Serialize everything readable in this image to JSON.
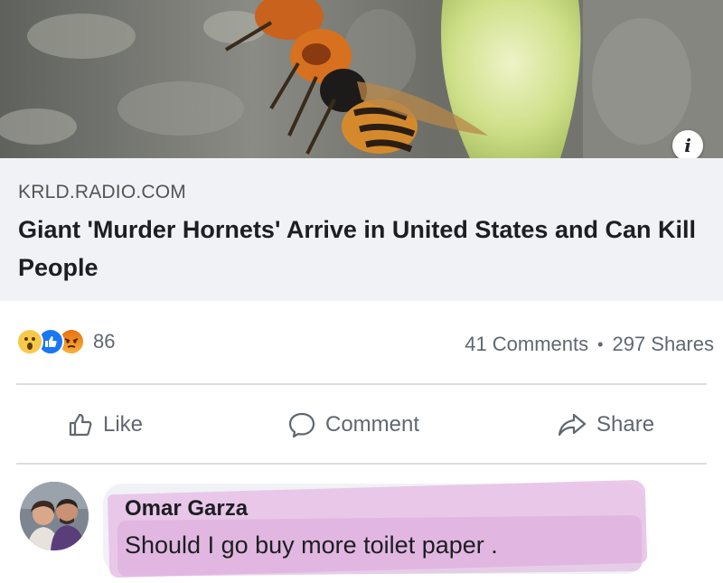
{
  "link_preview": {
    "domain": "KRLD.RADIO.COM",
    "title": "Giant 'Murder Hornets' Arrive in United States and Can Kill People",
    "info_icon": "info-icon",
    "info_glyph": "i"
  },
  "stats": {
    "reactions": [
      "wow-reaction-icon",
      "like-reaction-icon",
      "angry-reaction-icon"
    ],
    "reaction_count": "86",
    "comments": "41 Comments",
    "separator": "•",
    "shares": "297 Shares"
  },
  "actions": {
    "like_label": "Like",
    "comment_label": "Comment",
    "share_label": "Share"
  },
  "comment": {
    "author": "Omar Garza",
    "text": "Should I go buy more toilet paper .",
    "highlight_color": "#e8bfe6"
  },
  "colors": {
    "link_bg": "#f0f2f5",
    "muted_text": "#606770",
    "like_blue": "#1877f2",
    "wow_yellow": "#f7c94b",
    "angry_orange": "#e9710f"
  }
}
